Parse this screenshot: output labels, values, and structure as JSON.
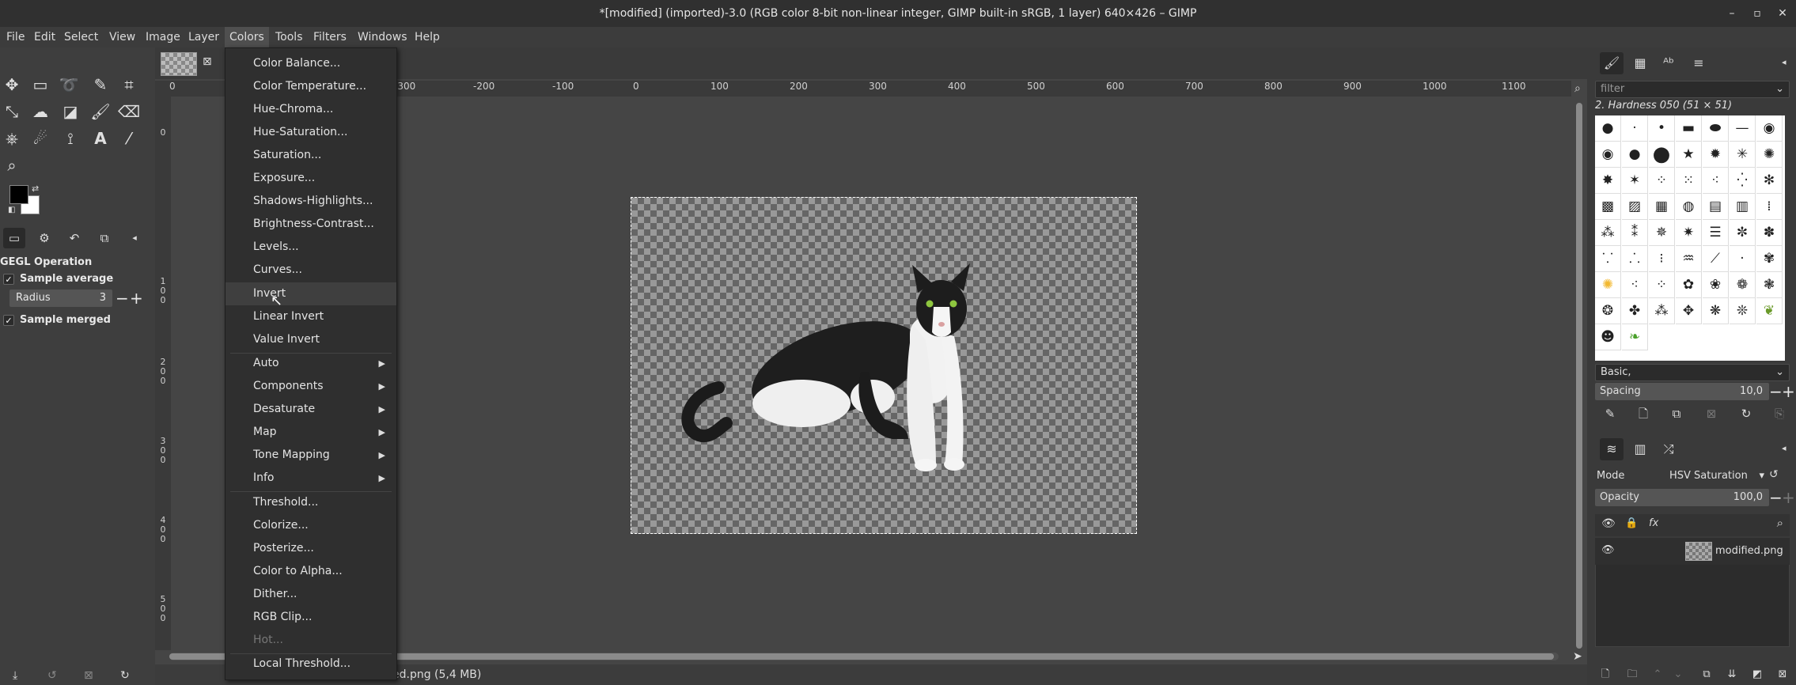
{
  "window": {
    "title": "*[modified] (imported)-3.0 (RGB color 8-bit non-linear integer, GIMP built-in sRGB, 1 layer) 640×426 – GIMP",
    "minimize": "–",
    "maximize": "▫",
    "close": "✕"
  },
  "menubar": [
    "File",
    "Edit",
    "Select",
    "View",
    "Image",
    "Layer",
    "Colors",
    "Tools",
    "Filters",
    "Windows",
    "Help"
  ],
  "tool_options": {
    "title": "GEGL Operation",
    "sample_average": "Sample average",
    "radius_label": "Radius",
    "radius_value": "3",
    "sample_merged": "Sample merged"
  },
  "ruler": {
    "h_labels": [
      "0",
      "-300",
      "-200",
      "-100",
      "0",
      "100",
      "200",
      "300",
      "400",
      "500",
      "600",
      "700",
      "800",
      "900",
      "1000",
      "1100"
    ],
    "v_labels": [
      "0",
      "1",
      "0",
      "0",
      "2",
      "0",
      "0",
      "3",
      "0",
      "0",
      "4",
      "0",
      "0",
      "5",
      "0",
      "0"
    ]
  },
  "statusbar": {
    "file_info": "ed.png (5,4 MB)"
  },
  "colors_menu": {
    "group1": [
      "Color Balance...",
      "Color Temperature...",
      "Hue-Chroma...",
      "Hue-Saturation...",
      "Saturation...",
      "Exposure...",
      "Shadows-Highlights...",
      "Brightness-Contrast...",
      "Levels...",
      "Curves..."
    ],
    "group2": [
      "Invert",
      "Linear Invert",
      "Value Invert"
    ],
    "group3": [
      "Auto",
      "Components",
      "Desaturate",
      "Map",
      "Tone Mapping",
      "Info"
    ],
    "group4": [
      "Threshold...",
      "Colorize...",
      "Posterize...",
      "Color to Alpha...",
      "Dither...",
      "RGB Clip...",
      "Hot..."
    ],
    "group5": [
      "Local Threshold..."
    ],
    "hovered": "Invert",
    "disabled": "Hot..."
  },
  "brushes": {
    "filter_placeholder": "filter",
    "current": "2. Hardness 050 (51 × 51)",
    "preset": "Basic,",
    "spacing_label": "Spacing",
    "spacing_value": "10,0"
  },
  "layers": {
    "mode_label": "Mode",
    "mode_value": "HSV Saturation",
    "opacity_label": "Opacity",
    "opacity_value": "100,0",
    "layer_name": "modified.png"
  }
}
